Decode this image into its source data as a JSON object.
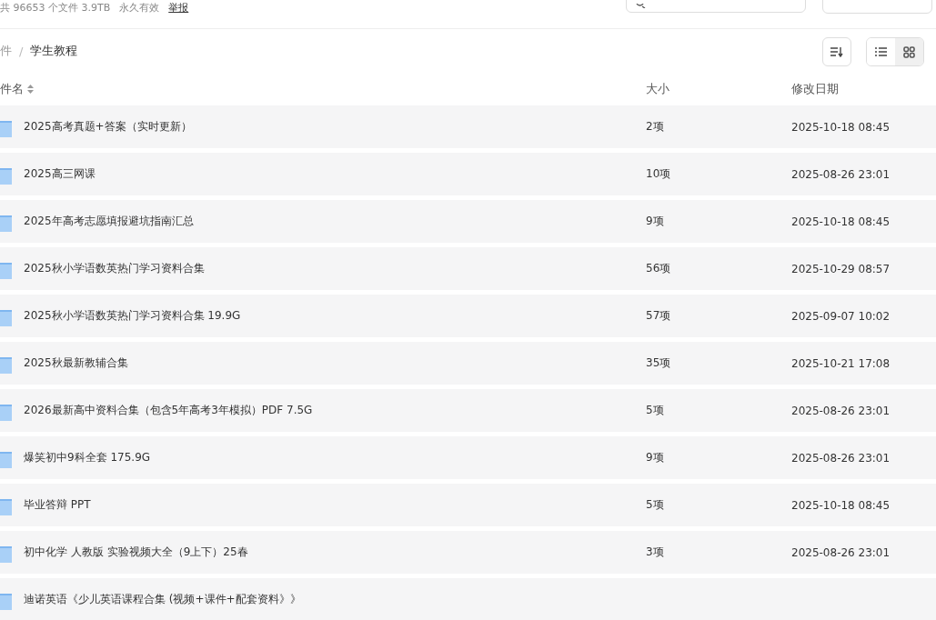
{
  "share_info": {
    "summary": "共 96653 个文件 3.9TB",
    "validity": "永久有效",
    "report_link": "举报"
  },
  "breadcrumb": {
    "separator": "/",
    "items": [
      {
        "label": "件",
        "current": false
      },
      {
        "label": "学生教程",
        "current": true
      }
    ]
  },
  "view_toggle": [
    {
      "kind": "list",
      "selected": false
    },
    {
      "kind": "grid",
      "selected": true
    }
  ],
  "table": {
    "columns": [
      "件名",
      "大小",
      "修改日期"
    ],
    "rows": [
      {
        "name": "2025高考真题+答案（实时更新）",
        "size": "2项",
        "modified": "2025-10-18 08:45"
      },
      {
        "name": "2025高三网课",
        "size": "10项",
        "modified": "2025-08-26 23:01"
      },
      {
        "name": "2025年高考志愿填报避坑指南汇总",
        "size": "9项",
        "modified": "2025-10-18 08:45"
      },
      {
        "name": "2025秋小学语数英热门学习资料合集",
        "size": "56项",
        "modified": "2025-10-29 08:57"
      },
      {
        "name": "2025秋小学语数英热门学习资料合集 19.9G",
        "size": "57项",
        "modified": "2025-09-07 10:02"
      },
      {
        "name": "2025秋最新教辅合集",
        "size": "35项",
        "modified": "2025-10-21 17:08"
      },
      {
        "name": "2026最新高中资料合集（包含5年高考3年模拟）PDF 7.5G",
        "size": "5项",
        "modified": "2025-08-26 23:01"
      },
      {
        "name": "爆笑初中9科全套 175.9G",
        "size": "9项",
        "modified": "2025-08-26 23:01"
      },
      {
        "name": "毕业答辩 PPT",
        "size": "5项",
        "modified": "2025-10-18 08:45"
      },
      {
        "name": "初中化学 人教版 实验视频大全（9上下）25春",
        "size": "3项",
        "modified": "2025-08-26 23:01"
      },
      {
        "name": "迪诺英语《少儿英语课程合集 (视频+课件+配套资料》》"
      }
    ]
  }
}
